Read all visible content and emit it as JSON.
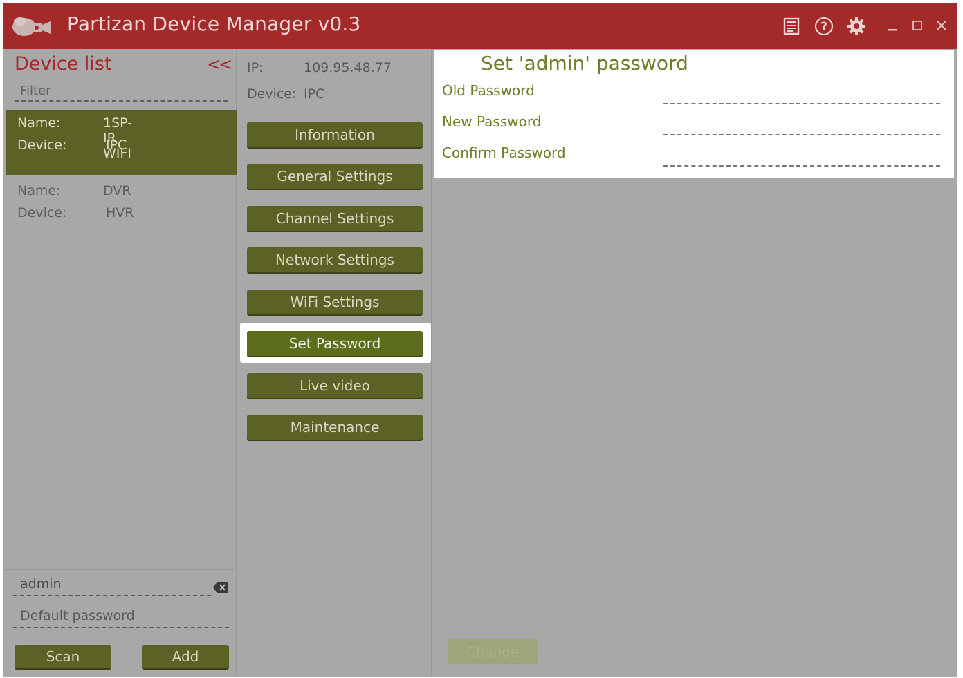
{
  "titlebar": {
    "title": "Partizan Device Manager v0.3",
    "icons": [
      "logo-icon",
      "manual-icon",
      "help-icon",
      "settings-gear-icon",
      "minimize-icon",
      "maximize-icon",
      "close-icon"
    ]
  },
  "device_list": {
    "title": "Device list",
    "collapse_label": "<<",
    "filter_placeholder": "Filter",
    "devices": [
      {
        "name_key": "Name:",
        "name": "1SP-IR WIFI",
        "device_key": "Device:",
        "device": "IPC",
        "selected": true
      },
      {
        "name_key": "Name:",
        "name": "DVR",
        "device_key": "Device:",
        "device": "HVR",
        "selected": false
      }
    ],
    "login_value": "admin",
    "password_placeholder": "Default password",
    "scan_label": "Scan",
    "add_label": "Add"
  },
  "device_info": {
    "ip_key": "IP:",
    "ip_value": "109.95.48.77",
    "device_key": "Device:",
    "device_value": "IPC"
  },
  "menu": [
    {
      "label": "Information",
      "active": false
    },
    {
      "label": "General Settings",
      "active": false
    },
    {
      "label": "Channel Settings",
      "active": false
    },
    {
      "label": "Network Settings",
      "active": false
    },
    {
      "label": "WiFi Settings",
      "active": false
    },
    {
      "label": "Set Password",
      "active": true
    },
    {
      "label": "Live video",
      "active": false
    },
    {
      "label": "Maintenance",
      "active": false
    }
  ],
  "password_panel": {
    "title": "Set 'admin' password",
    "old_label": "Old Password",
    "new_label": "New Password",
    "confirm_label": "Confirm Password",
    "change_label": "Change"
  },
  "colors": {
    "titlebar": "#a42a2a",
    "accent_olive": "#5c6226",
    "panel_text": "#6d7e2b",
    "background": "#a8a8a8"
  }
}
